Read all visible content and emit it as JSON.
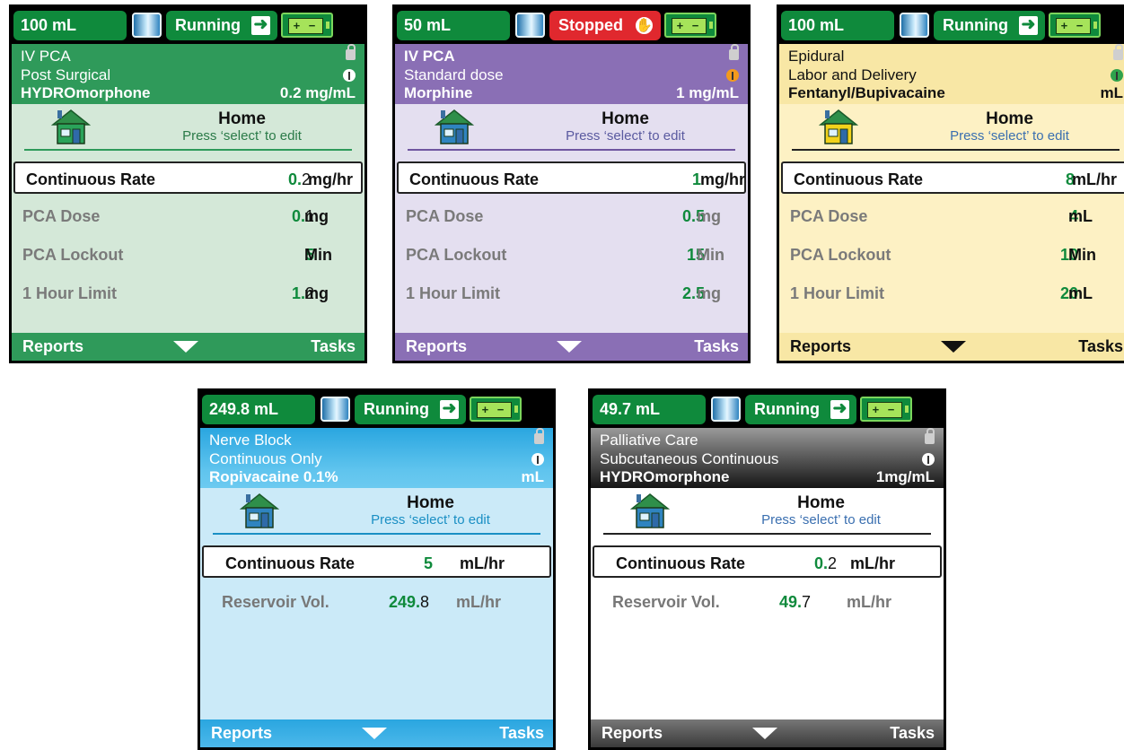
{
  "pumps": [
    {
      "theme": {
        "bg": "#d4e8d8",
        "info": "#2f9a5a",
        "foot": "#2f9a5a",
        "line": "#2f9a5a"
      },
      "volume": "100 mL",
      "state": "Running",
      "state_icon": "running-person-icon",
      "program": "IV PCA",
      "mode": "Post Surgical",
      "drug": "HYDROmorphone",
      "concentration": "0.2 mg/mL",
      "connection_icon": "wireless-icon",
      "connection_color": "#ffffff",
      "home_title": "Home",
      "home_hint": "Press ‘select’ to edit",
      "house_color": "#2aa35a",
      "rows": [
        {
          "name": "Continuous Rate",
          "value_a": "0.",
          "value_b": "2",
          "unit": "mg/hr"
        },
        {
          "name": "PCA Dose",
          "value_a": "0.",
          "value_b": "1",
          "unit": "mg"
        },
        {
          "name": "PCA Lockout",
          "value_a": "5",
          "value_b": "",
          "unit": "Min"
        },
        {
          "name": "1 Hour Limit",
          "value_a": "1.",
          "value_b": "2",
          "unit": "mg"
        }
      ],
      "footer": {
        "left": "Reports",
        "right": "Tasks"
      }
    },
    {
      "theme": {
        "bg": "#e4dff0",
        "info": "#8a6fb5",
        "foot": "#8a6fb5",
        "line": "#6f55a0"
      },
      "volume": "50 mL",
      "state": "Stopped",
      "state_icon": "stop-hand-icon",
      "program": "IV PCA",
      "mode": "Standard dose",
      "drug": "Morphine",
      "concentration": "1 mg/mL",
      "connection_icon": "wireless-icon",
      "connection_color": "#f39a1c",
      "home_title": "Home",
      "home_hint": "Press ‘select’ to edit",
      "house_color": "#2f84c0",
      "rows": [
        {
          "name": "Continuous Rate",
          "value_a": "1",
          "value_b": "",
          "unit": "mg/hr"
        },
        {
          "name": "PCA Dose",
          "value_a": "0.5",
          "value_b": "",
          "unit": "mg"
        },
        {
          "name": "PCA Lockout",
          "value_a": "15",
          "value_b": "",
          "unit": "Min"
        },
        {
          "name": "1 Hour Limit",
          "value_a": "2.5",
          "value_b": "",
          "unit": "mg"
        }
      ],
      "footer": {
        "left": "Reports",
        "right": "Tasks"
      }
    },
    {
      "theme": {
        "bg": "#fdf1c4",
        "info": "#f8e7a5",
        "foot": "#f8e7a5",
        "line": "#222222"
      },
      "volume": "100 mL",
      "state": "Running",
      "state_icon": "running-person-icon",
      "program": "Epidural",
      "mode": "Labor and Delivery",
      "drug": "Fentanyl/Bupivacaine",
      "concentration": "mL",
      "connection_icon": "wireless-icon",
      "connection_color": "#2fa24c",
      "home_title": "Home",
      "home_hint": "Press ‘select’ to edit",
      "house_color": "#f2d21b",
      "rows": [
        {
          "name": "Continuous Rate",
          "value_a": "8",
          "value_b": "",
          "unit": "mL/hr"
        },
        {
          "name": "PCA Dose",
          "value_a": "4",
          "value_b": "",
          "unit": "mL"
        },
        {
          "name": "PCA Lockout",
          "value_a": "10",
          "value_b": "",
          "unit": "Min"
        },
        {
          "name": "1 Hour Limit",
          "value_a": "20",
          "value_b": "",
          "unit": "mL"
        }
      ],
      "footer": {
        "left": "Reports",
        "right": "Tasks"
      }
    },
    {
      "theme": {
        "bg": "#cbeaf8",
        "info": "#39b5e6",
        "foot": "#39b5e6",
        "line": "#1a8fc4"
      },
      "volume": "249.8 mL",
      "state": "Running",
      "state_icon": "running-person-icon",
      "program": "Nerve Block",
      "mode": "Continuous Only",
      "drug": "Ropivacaine 0.1%",
      "concentration": "mL",
      "connection_icon": "wireless-icon",
      "connection_color": "#ffffff",
      "home_title": "Home",
      "home_hint": "Press ‘select’ to edit",
      "house_color": "#2f84c0",
      "rows": [
        {
          "name": "Continuous Rate",
          "value_a": "5",
          "value_b": "",
          "unit": "mL/hr"
        },
        {
          "name": "Reservoir Vol.",
          "value_a": "249.",
          "value_b": "8",
          "unit": "mL/hr"
        }
      ],
      "footer": {
        "left": "Reports",
        "right": "Tasks"
      }
    },
    {
      "theme": {
        "bg": "#ffffff",
        "info": "#6e6e6e",
        "foot": "#6e6e6e",
        "line": "#222222"
      },
      "volume": "49.7 mL",
      "state": "Running",
      "state_icon": "running-person-icon",
      "program": "Palliative Care",
      "mode": "Subcutaneous Continuous",
      "drug": "HYDROmorphone",
      "concentration": "1mg/mL",
      "connection_icon": "wireless-icon",
      "connection_color": "#ffffff",
      "home_title": "Home",
      "home_hint": "Press ‘select’ to edit",
      "house_color": "#2f84c0",
      "rows": [
        {
          "name": "Continuous Rate",
          "value_a": "0.",
          "value_b": "2",
          "unit": "mL/hr"
        },
        {
          "name": "Reservoir Vol.",
          "value_a": "49.",
          "value_b": "7",
          "unit": "mL/hr"
        }
      ],
      "footer": {
        "left": "Reports",
        "right": "Tasks"
      }
    }
  ]
}
